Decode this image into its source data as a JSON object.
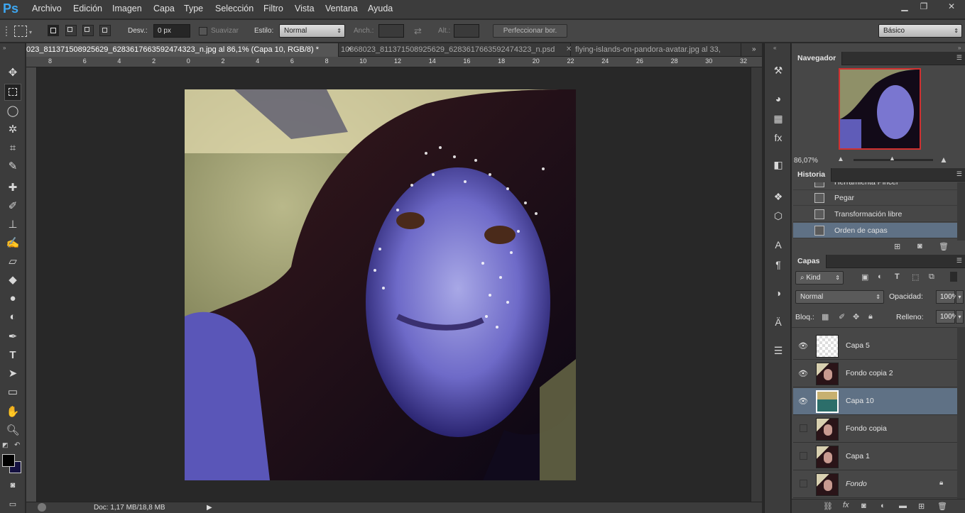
{
  "app": {
    "logo": "Ps"
  },
  "menu": [
    "Archivo",
    "Edición",
    "Imagen",
    "Capa",
    "Type",
    "Selección",
    "Filtro",
    "Vista",
    "Ventana",
    "Ayuda"
  ],
  "options": {
    "feather_label": "Desv.:",
    "feather_value": "0 px",
    "antialias_label": "Suavizar",
    "style_label": "Estilo:",
    "style_value": "Normal",
    "width_label": "Anch.:",
    "height_label": "Alt.:",
    "refine_button": "Perfeccionar bor.",
    "workspace": "Básico"
  },
  "tabs": [
    {
      "label": "023_811371508925629_6283617663592474323_n.jpg al 86,1% (Capa 10, RGB/8) *",
      "active": true
    },
    {
      "label": "10868023_811371508925629_6283617663592474323_n.psd",
      "active": false
    },
    {
      "label": "flying-islands-on-pandora-avatar.jpg al 33,",
      "active": false
    }
  ],
  "ruler_h": [
    "8",
    "6",
    "4",
    "2",
    "0",
    "2",
    "4",
    "6",
    "8",
    "10",
    "12",
    "14",
    "16",
    "18",
    "20",
    "22",
    "24",
    "26",
    "28",
    "30",
    "32"
  ],
  "status": {
    "doc": "Doc: 1,17 MB/18,8 MB"
  },
  "navigator": {
    "title": "Navegador",
    "zoom": "86,07%"
  },
  "history": {
    "title": "Historia",
    "items": [
      {
        "label": "Herramienta Pincel"
      },
      {
        "label": "Pegar"
      },
      {
        "label": "Transformación libre"
      },
      {
        "label": "Orden de capas",
        "selected": true
      }
    ]
  },
  "layers": {
    "title": "Capas",
    "kind_label": "Kind",
    "blend_mode": "Normal",
    "opacity_label": "Opacidad:",
    "opacity_value": "100%",
    "lock_label": "Bloq.:",
    "fill_label": "Relleno:",
    "fill_value": "100%",
    "items": [
      {
        "name": "Capa 5",
        "visible": true,
        "selected": false
      },
      {
        "name": "Fondo copia 2",
        "visible": true,
        "selected": false
      },
      {
        "name": "Capa 10",
        "visible": true,
        "selected": true
      },
      {
        "name": "Fondo copia",
        "visible": false,
        "selected": false
      },
      {
        "name": "Capa 1",
        "visible": false,
        "selected": false
      },
      {
        "name": "Fondo",
        "visible": false,
        "selected": false,
        "locked": true
      }
    ]
  },
  "colors": {
    "foreground": "#000000",
    "background": "#141040"
  }
}
